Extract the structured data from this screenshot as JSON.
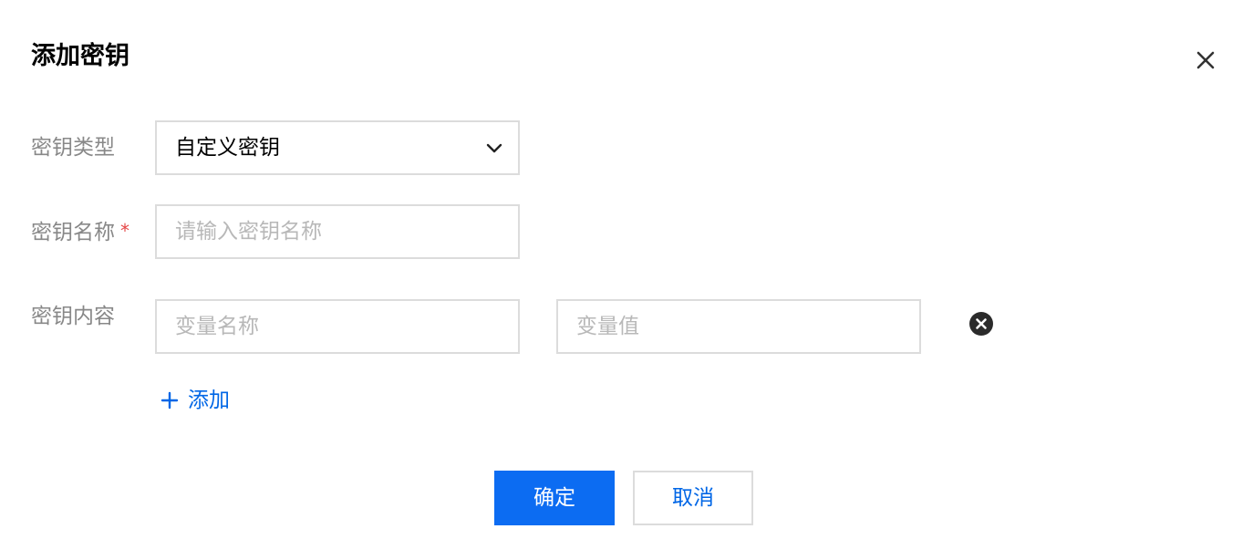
{
  "dialog": {
    "title": "添加密钥",
    "close_icon": "close-icon"
  },
  "form": {
    "key_type": {
      "label": "密钥类型",
      "value": "自定义密钥",
      "icon": "chevron-down-icon"
    },
    "key_name": {
      "label": "密钥名称",
      "required_mark": "*",
      "placeholder": "请输入密钥名称",
      "value": ""
    },
    "key_content": {
      "label": "密钥内容",
      "var_name_placeholder": "变量名称",
      "var_value_placeholder": "变量值",
      "remove_icon": "remove-circle-icon",
      "add_label": "添加",
      "add_icon": "plus-icon"
    }
  },
  "footer": {
    "confirm_label": "确定",
    "cancel_label": "取消"
  },
  "colors": {
    "primary": "#0c6cf2",
    "link": "#0066e6",
    "required": "#e54545",
    "label": "#888888",
    "border": "#dcdcdc"
  }
}
